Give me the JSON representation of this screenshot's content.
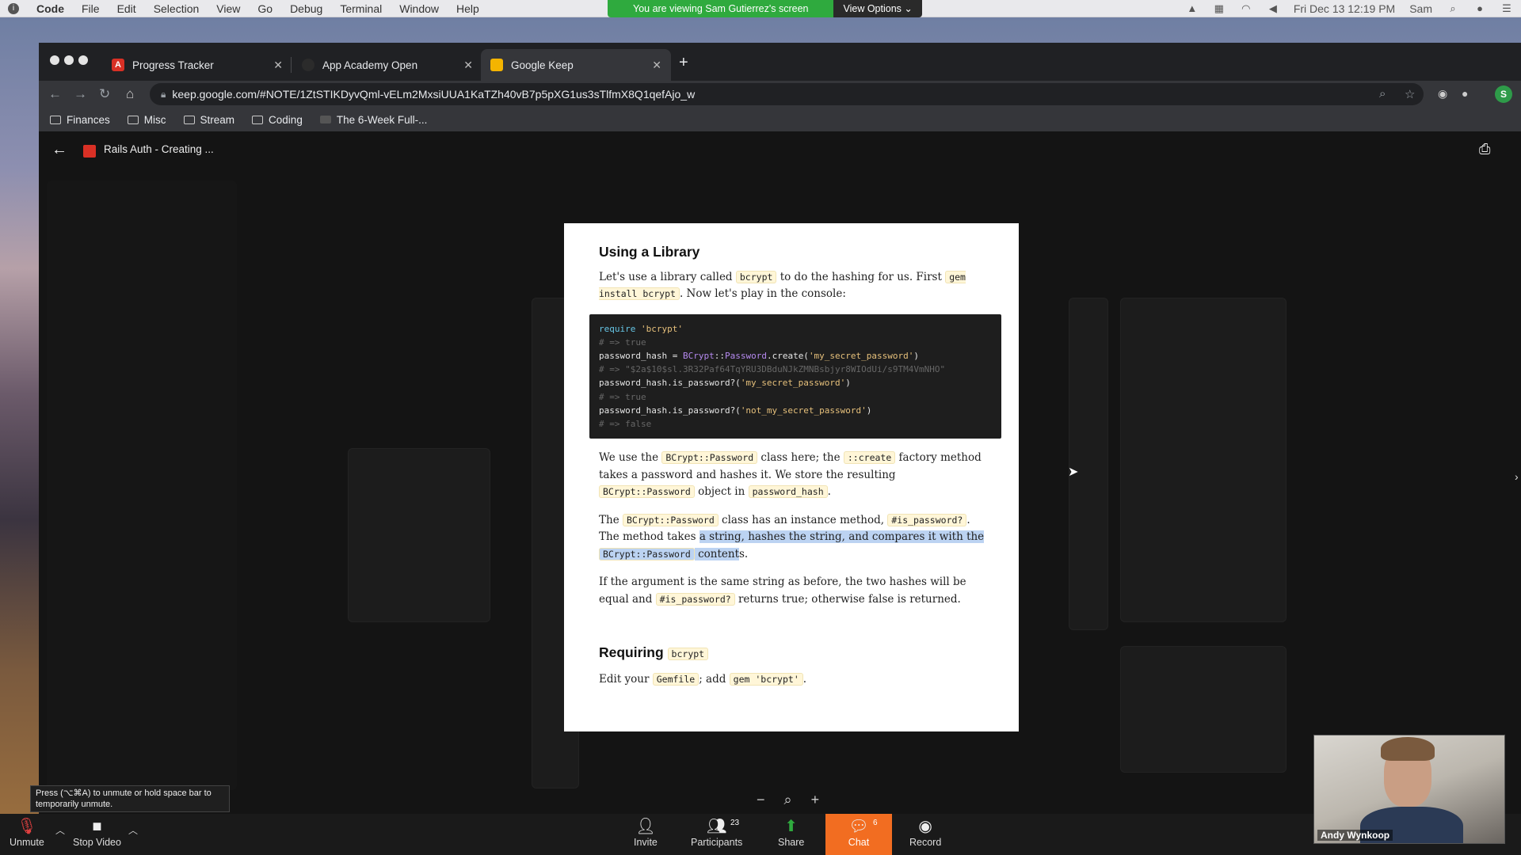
{
  "menubar": {
    "app": "Code",
    "items": [
      "File",
      "Edit",
      "Selection",
      "View",
      "Go",
      "Debug",
      "Terminal",
      "Window",
      "Help"
    ],
    "clock": "Fri Dec 13  12:19 PM",
    "user": "Sam"
  },
  "share_banner": {
    "message": "You are viewing Sam Gutierrez's screen",
    "options_label": "View Options"
  },
  "browser": {
    "tabs": [
      {
        "title": "Progress Tracker",
        "favicon_letter": "A",
        "favicon_color": "#d93025"
      },
      {
        "title": "App Academy Open",
        "favicon_letter": "",
        "favicon_color": "#2b2b2b"
      },
      {
        "title": "Google Keep",
        "favicon_letter": "",
        "favicon_color": "#f4b400"
      }
    ],
    "url": "keep.google.com/#NOTE/1ZtSTIKDyvQml-vELm2MxsiUUA1KaTZh40vB7p5pXG1us3sTlfmX8Q1qefAjo_w",
    "profile_initial": "S",
    "bookmarks": [
      "Finances",
      "Misc",
      "Stream",
      "Coding",
      "The 6-Week Full-..."
    ]
  },
  "keep": {
    "doc_title": "Rails Auth - Creating ..."
  },
  "pdf": {
    "heading1": "Using a Library",
    "p1": {
      "t1": "Let's use a library called ",
      "c1": "bcrypt",
      "t2": " to do the hashing for us. First ",
      "c2": "gem install bcrypt",
      "t3": ". Now let's play in the console:"
    },
    "code": {
      "l1_kw": "require",
      "l1_str": "'bcrypt'",
      "l2": "# => true",
      "l3_a": "password_hash = ",
      "l3_cls": "BCrypt",
      "l3_b": "::",
      "l3_cls2": "Password",
      "l3_c": ".create(",
      "l3_str": "'my_secret_password'",
      "l3_d": ")",
      "l4": "# => \"$2a$10$sl.3R32Paf64TqYRU3DBduNJkZMNBsbjyr8WIOdUi/s9TM4VmNHO\"",
      "l5_a": "password_hash.is_password?(",
      "l5_str": "'my_secret_password'",
      "l5_b": ")",
      "l6": "# => true",
      "l7_a": "password_hash.is_password?(",
      "l7_str": "'not_my_secret_password'",
      "l7_b": ")",
      "l8": "# => false"
    },
    "p2": {
      "t1": "We use the ",
      "c1": "BCrypt::Password",
      "t2": " class here; the ",
      "c2": "::create",
      "t3": " factory method takes a password and hashes it. We store the resulting ",
      "c3": "BCrypt::Password",
      "t4": " object in ",
      "c4": "password_hash",
      "t5": "."
    },
    "p3": {
      "t1": "The ",
      "c1": "BCrypt::Password",
      "t2": " class has an instance method, ",
      "c2": "#is_password?",
      "t3": ". The method takes ",
      "h1": "a string, hashes the string, and compares it with the ",
      "c3": "BCrypt::Password",
      "h2": " content",
      "t4": "s."
    },
    "p4": {
      "t1": "If the argument is the same string as before, the two hashes will be equal and ",
      "c1": "#is_password?",
      "t2": " returns true; otherwise false is returned."
    },
    "heading2": "Requiring",
    "heading2_code": "bcrypt",
    "p5": {
      "t1": "Edit your ",
      "c1": "Gemfile",
      "t2": "; add ",
      "c2": "gem 'bcrypt'",
      "t3": "."
    }
  },
  "zoom": {
    "tooltip": "Press  (⌥⌘A) to unmute or hold space bar to temporarily unmute.",
    "buttons": {
      "unmute": "Unmute",
      "stop_video": "Stop Video",
      "invite": "Invite",
      "participants": "Participants",
      "participants_count": "23",
      "share": "Share",
      "chat": "Chat",
      "chat_count": "6",
      "record": "Record"
    },
    "video_name": "Andy Wynkoop",
    "accent": "#f26d21"
  }
}
